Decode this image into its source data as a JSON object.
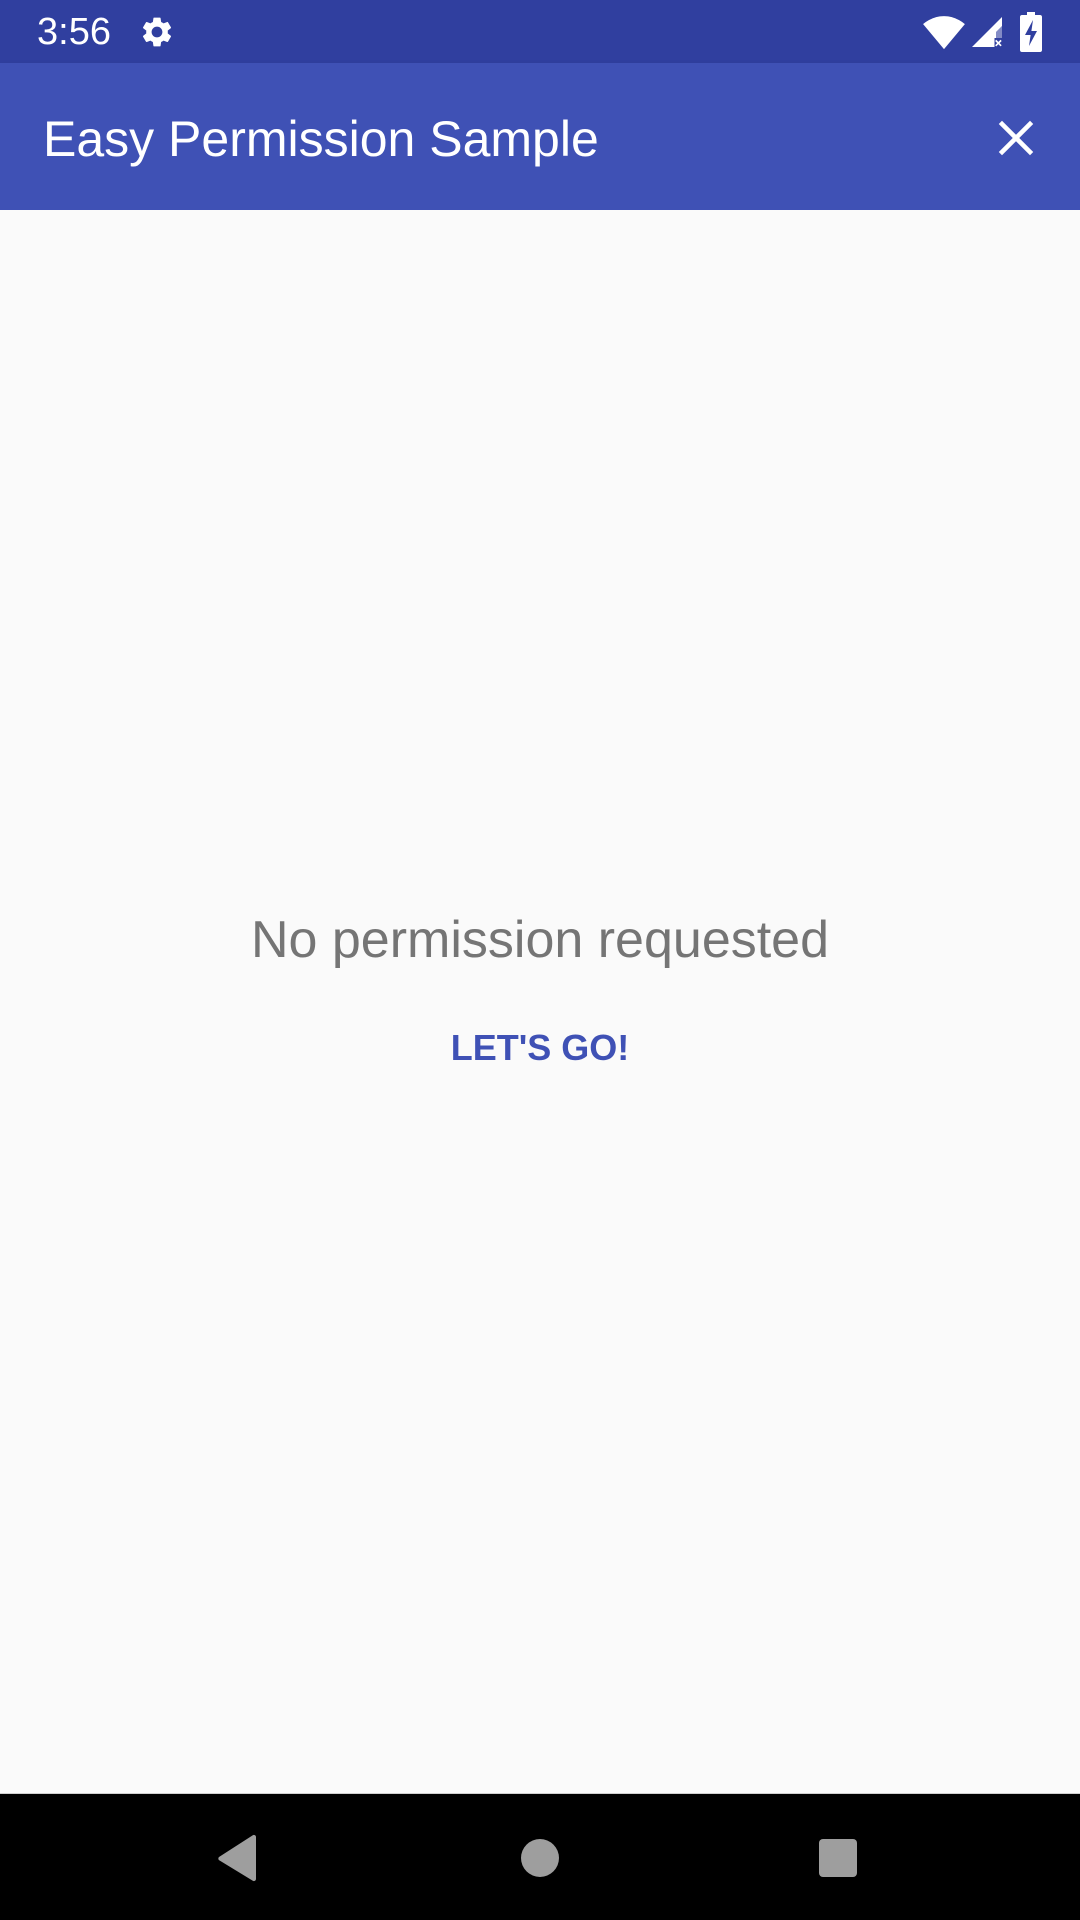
{
  "status_bar": {
    "time": "3:56",
    "icons": [
      "gear-icon",
      "wifi-icon",
      "signal-icon",
      "battery-charging-icon"
    ],
    "background_color": "#303f9f"
  },
  "app_bar": {
    "title": "Easy Permission Sample",
    "close_icon": "close-icon",
    "background_color": "#3f51b5"
  },
  "main": {
    "message": "No permission requested",
    "action_label": "LET'S GO!",
    "accent_color": "#3f51b5"
  },
  "nav_bar": {
    "buttons": [
      "back-icon",
      "home-icon",
      "recents-icon"
    ]
  }
}
